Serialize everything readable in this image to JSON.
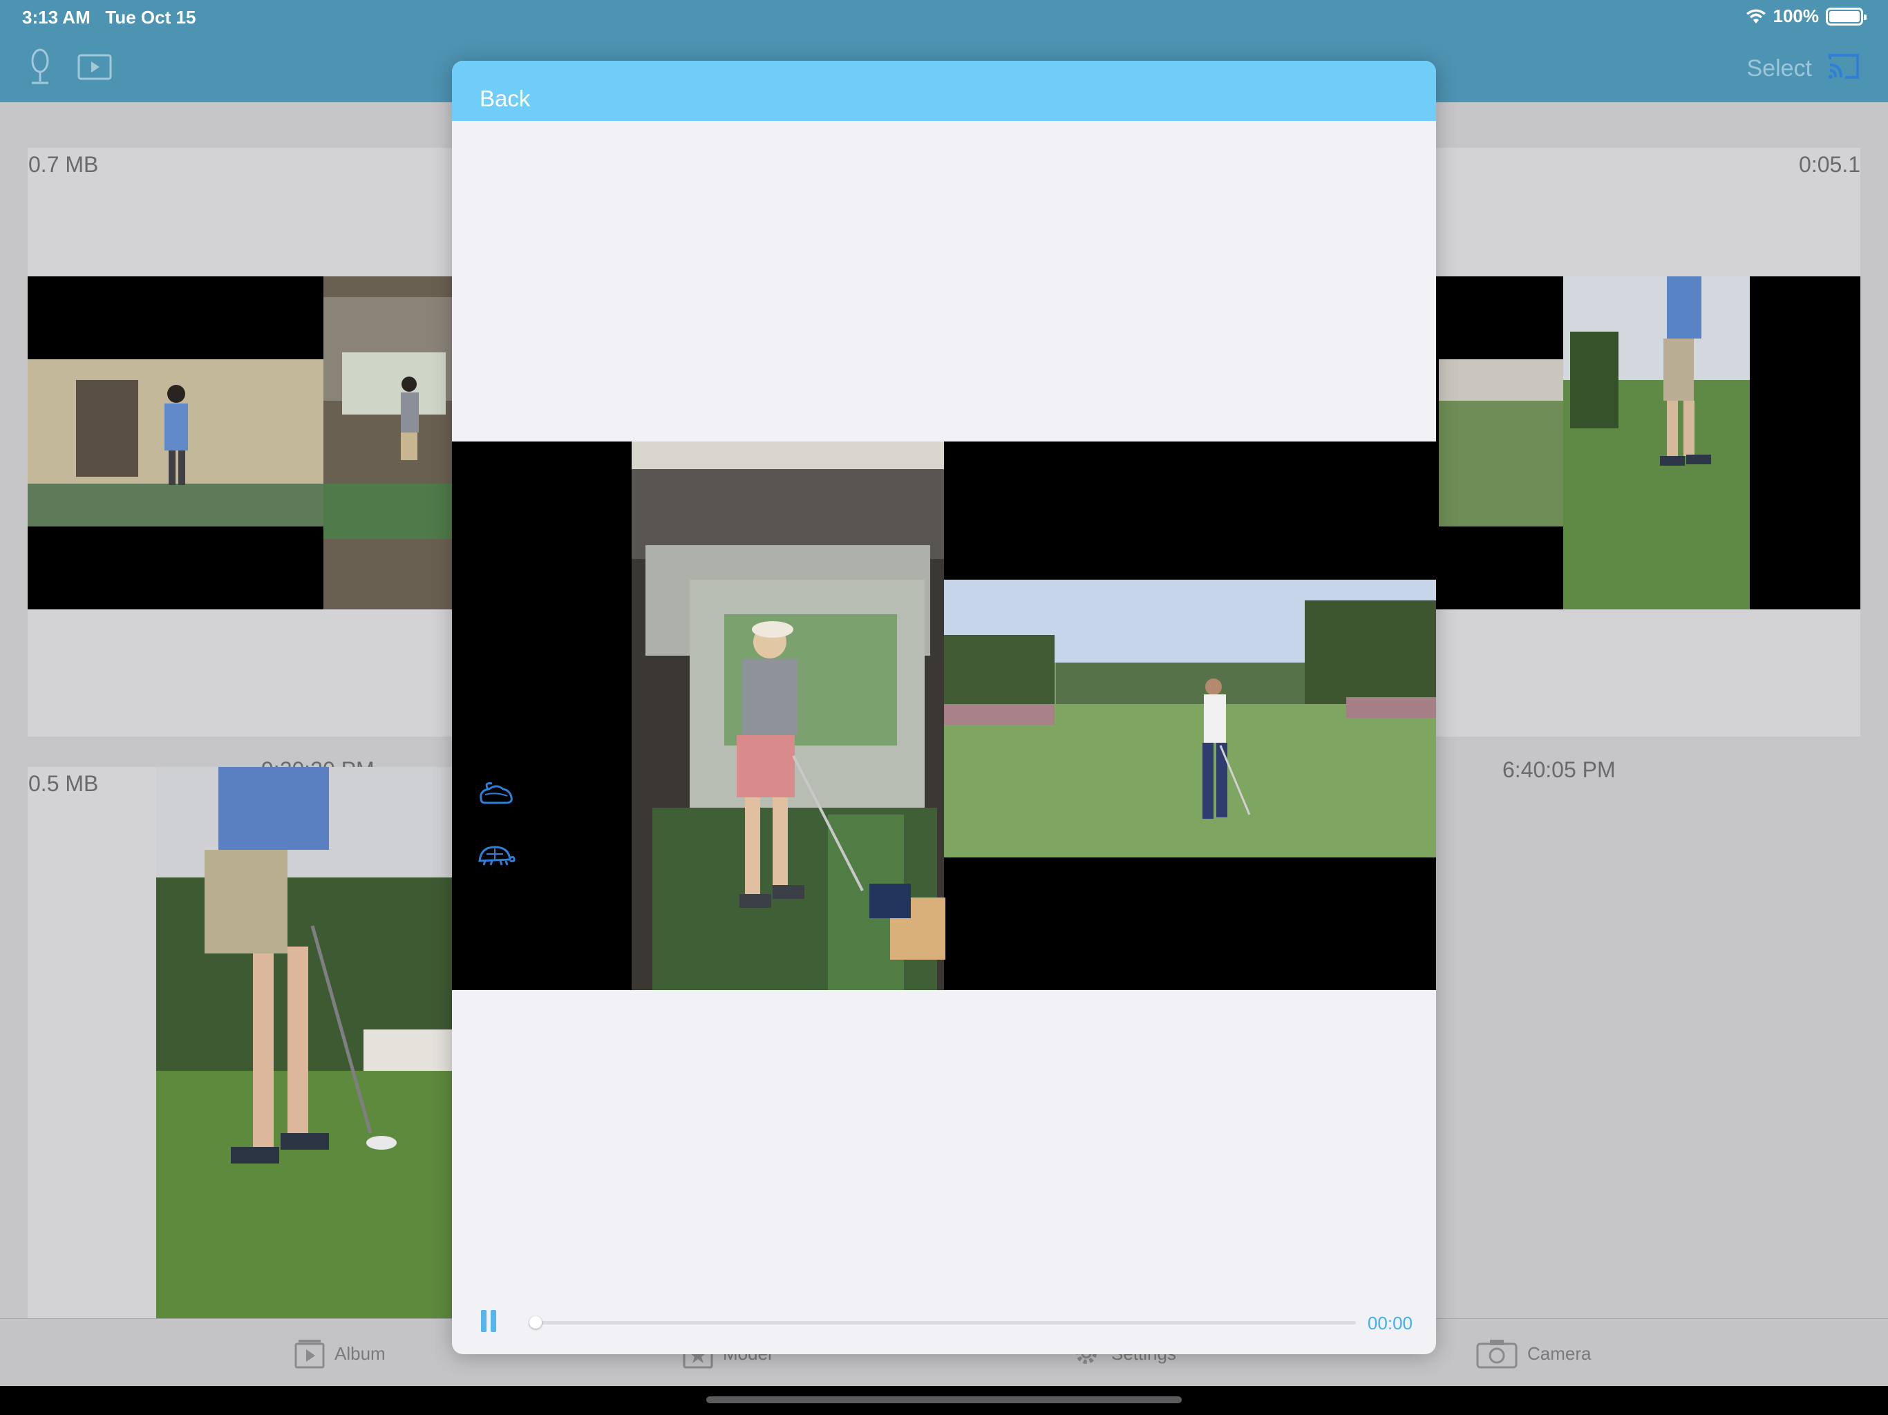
{
  "status": {
    "time": "3:13 AM",
    "date": "Tue Oct 15",
    "battery": "100%"
  },
  "nav": {
    "select_label": "Select",
    "icons": [
      "microphone-icon",
      "video-play-icon",
      "cast-icon"
    ]
  },
  "gallery": {
    "cells": [
      {
        "size": "0.7 MB",
        "time": "9:20:20 PM"
      },
      {
        "duration": "0:05.1",
        "time": "6:40:05 PM"
      },
      {
        "size": "0.5 MB"
      }
    ]
  },
  "tabs": [
    {
      "label": "Album",
      "icon": "album-icon"
    },
    {
      "label": "Model",
      "icon": "star-icon"
    },
    {
      "label": "Settings",
      "icon": "gear-icon"
    },
    {
      "label": "Camera",
      "icon": "camera-icon"
    }
  ],
  "modal": {
    "back_label": "Back",
    "player": {
      "current_time": "00:00",
      "progress": 0,
      "fast_icon": "rabbit-icon",
      "slow_icon": "turtle-icon",
      "state": "pause-icon"
    }
  },
  "colors": {
    "header": "#70cdf7",
    "accent": "#55b6ea",
    "modal_background": "#f2f2f6"
  }
}
